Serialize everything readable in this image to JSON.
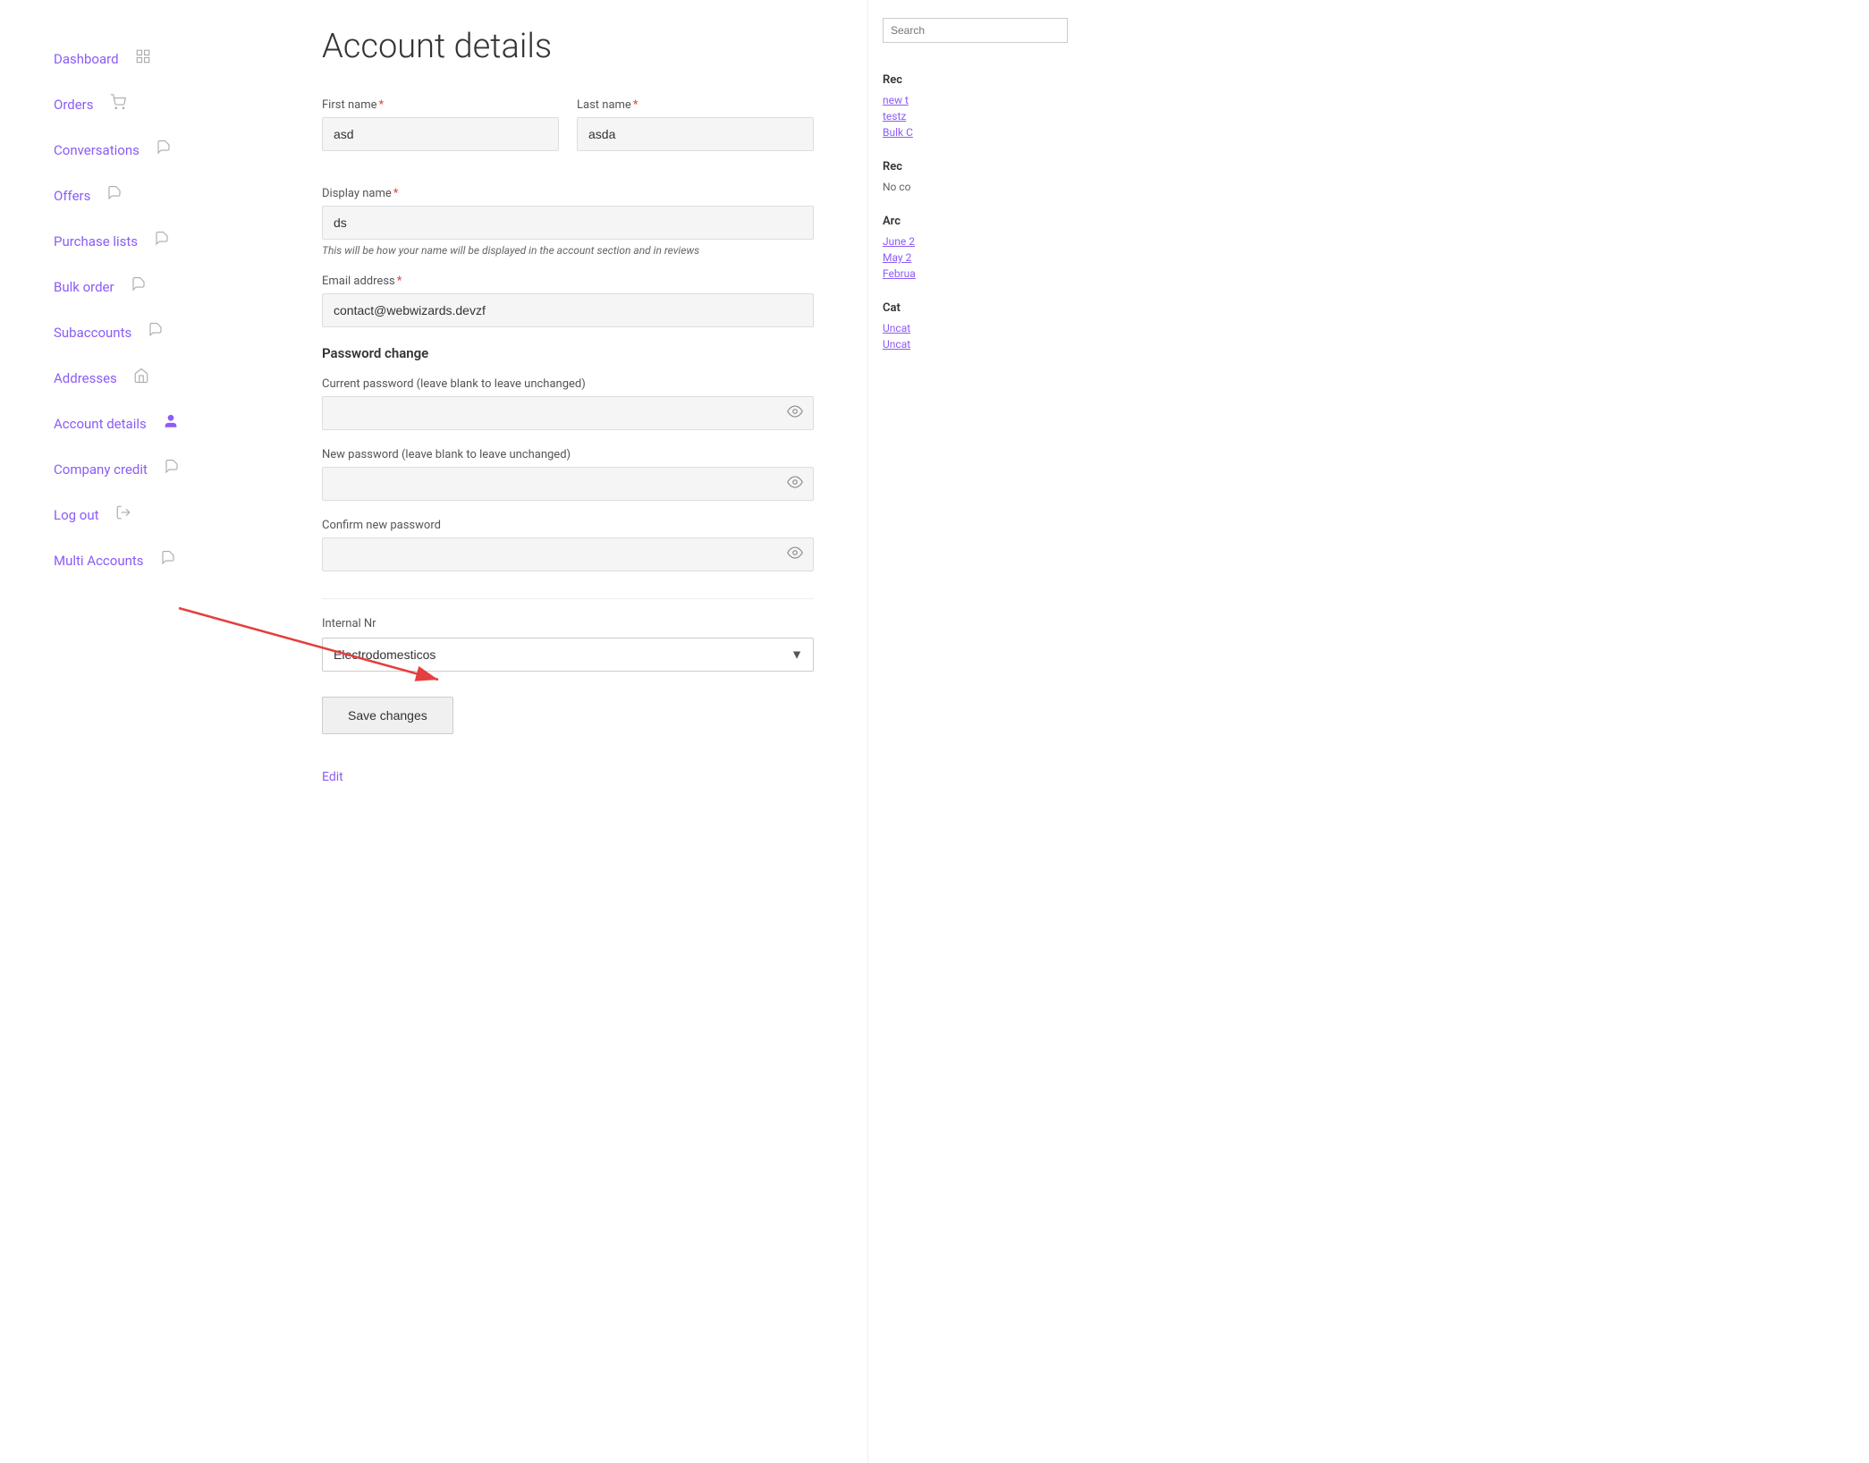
{
  "page": {
    "title": "Account details"
  },
  "sidebar": {
    "items": [
      {
        "id": "dashboard",
        "label": "Dashboard",
        "icon": "🏠"
      },
      {
        "id": "orders",
        "label": "Orders",
        "icon": "🛒"
      },
      {
        "id": "conversations",
        "label": "Conversations",
        "icon": "📄"
      },
      {
        "id": "offers",
        "label": "Offers",
        "icon": "📄"
      },
      {
        "id": "purchase-lists",
        "label": "Purchase lists",
        "icon": "📄"
      },
      {
        "id": "bulk-order",
        "label": "Bulk order",
        "icon": "📄"
      },
      {
        "id": "subaccounts",
        "label": "Subaccounts",
        "icon": "📄"
      },
      {
        "id": "addresses",
        "label": "Addresses",
        "icon": "🏠"
      },
      {
        "id": "account-details",
        "label": "Account details",
        "icon": "👤"
      },
      {
        "id": "company-credit",
        "label": "Company credit",
        "icon": "📄"
      },
      {
        "id": "log-out",
        "label": "Log out",
        "icon": "➜"
      },
      {
        "id": "multi-accounts",
        "label": "Multi Accounts",
        "icon": "📄"
      }
    ]
  },
  "form": {
    "first_name_label": "First name",
    "first_name_value": "asd",
    "last_name_label": "Last name",
    "last_name_value": "asda",
    "display_name_label": "Display name",
    "display_name_value": "ds",
    "display_name_hint": "This will be how your name will be displayed in the account section and in reviews",
    "email_label": "Email address",
    "email_value": "contact@webwizards.devzf",
    "password_section_title": "Password change",
    "current_password_label": "Current password (leave blank to leave unchanged)",
    "new_password_label": "New password (leave blank to leave unchanged)",
    "confirm_password_label": "Confirm new password",
    "internal_nr_label": "Internal Nr",
    "internal_nr_selected": "Electrodomesticos",
    "internal_nr_options": [
      "Electrodomesticos"
    ],
    "save_button_label": "Save changes"
  },
  "edit_link": "Edit",
  "right_panel": {
    "search_placeholder": "Search",
    "recent_title": "Rec",
    "recent_links": [
      "new t",
      "testz",
      "Bulk C"
    ],
    "recent2_title": "Rec",
    "recent2_text": "No co",
    "archive_title": "Arc",
    "archive_links": [
      "June 2",
      "May 2",
      "Februa"
    ],
    "categories_title": "Cat",
    "category_links": [
      "Uncat",
      "Uncat"
    ]
  }
}
